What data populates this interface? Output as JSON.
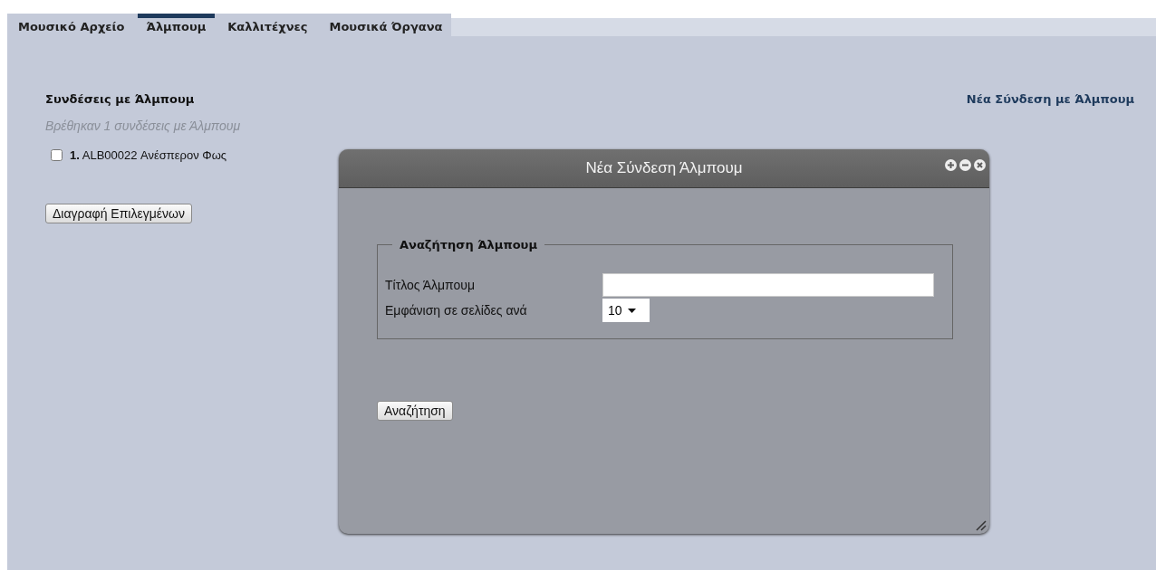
{
  "tabs": [
    {
      "label": "Μουσικό Αρχείο",
      "selected": false
    },
    {
      "label": "Άλμπουμ",
      "selected": true
    },
    {
      "label": "Καλλιτέχνες",
      "selected": false
    },
    {
      "label": "Μουσικά Όργανα",
      "selected": false
    }
  ],
  "heading": "Συνδέσεις με Άλμπουμ",
  "new_link": "Νέα Σύνδεση με Άλμπουμ",
  "found_text": "Βρέθηκαν 1 συνδέσεις με Άλμπουμ",
  "items": [
    {
      "number": "1.",
      "text": "ALB00022 Ανέσπερον Φως",
      "checked": false
    }
  ],
  "delete_button": "Διαγραφή Επιλεγμένων",
  "dialog": {
    "title": "Νέα Σύνδεση Άλμπουμ",
    "legend": "Αναζήτηση Άλμπουμ",
    "fields": [
      {
        "kind": "text",
        "label": "Τίτλος Άλμπουμ"
      },
      {
        "kind": "select",
        "label": "Εμφάνιση σε σελίδες ανά",
        "value": "10"
      }
    ],
    "search_button": "Αναζήτηση"
  }
}
